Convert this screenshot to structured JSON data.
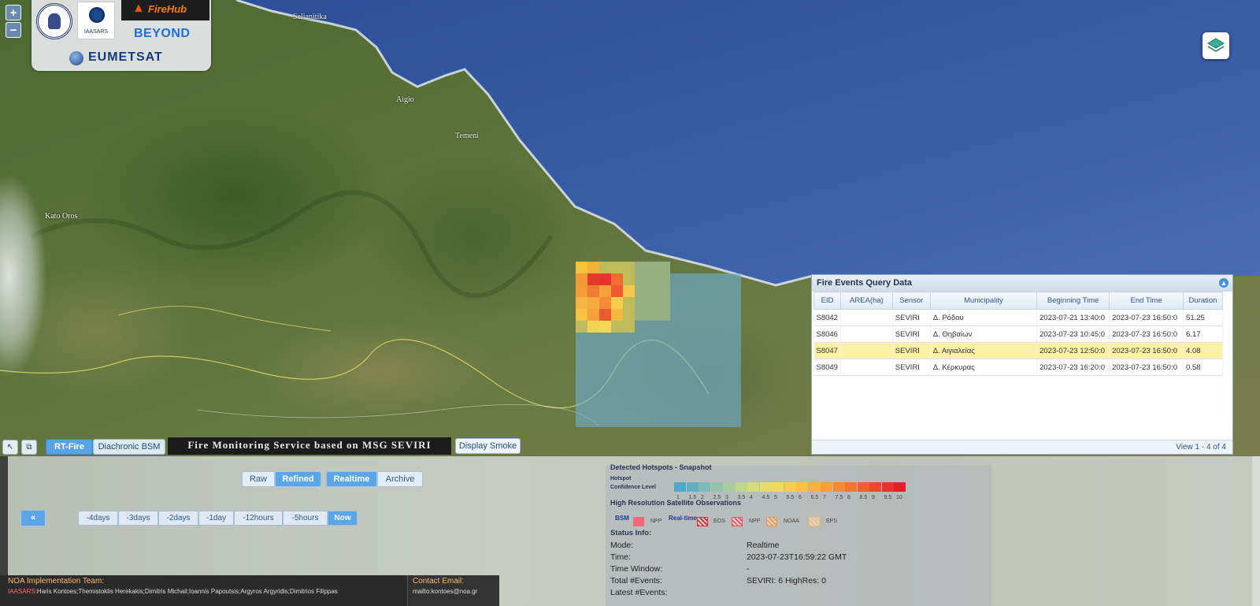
{
  "map": {
    "zoom_in": "+",
    "zoom_out": "−",
    "place_names": [
      "Selianitika",
      "Aigio",
      "Temeni",
      "Kato Oros"
    ],
    "logos": {
      "firehub": "FireHub",
      "beyond": "BEYOND",
      "eumetsat": "EUMETSAT",
      "iaasars": "IAASARS"
    },
    "layers_icon": "layers-icon"
  },
  "events_panel": {
    "title": "Fire Events Query Data",
    "columns": [
      "EID",
      "AREA(ha)",
      "Sensor",
      "Municipality",
      "Beginning Time",
      "End Time",
      "Duration"
    ],
    "rows": [
      {
        "eid": "S8042",
        "area": "",
        "sensor": "SEVIRI",
        "municipality": "Δ. Ρόδου",
        "begin": "2023-07-21 13:40:0",
        "end": "2023-07-23 16:50:0",
        "duration": "51.25"
      },
      {
        "eid": "S8046",
        "area": "",
        "sensor": "SEVIRI",
        "municipality": "Δ. Θηβαίων",
        "begin": "2023-07-23 10:45:0",
        "end": "2023-07-23 16:50:0",
        "duration": "6.17"
      },
      {
        "eid": "S8047",
        "area": "",
        "sensor": "SEVIRI",
        "municipality": "Δ. Αιγιαλείας",
        "begin": "2023-07-23 12:50:0",
        "end": "2023-07-23 16:50:0",
        "duration": "4.08"
      },
      {
        "eid": "S8049",
        "area": "",
        "sensor": "SEVIRI",
        "municipality": "Δ. Κέρκυρας",
        "begin": "2023-07-23 16:20:0",
        "end": "2023-07-23 16:50:0",
        "duration": "0.58"
      }
    ],
    "selected_row": 2,
    "footer": "View 1 - 4 of 4"
  },
  "toolbar": {
    "rt_fire": "RT-Fire",
    "diachronic": "Diachronic BSM",
    "title": "Fire Monitoring Service based on MSG SEVIRI",
    "display_smoke": "Display Smoke"
  },
  "controls": {
    "raw": "Raw",
    "refined": "Refined",
    "realtime": "Realtime",
    "archive": "Archive",
    "play": "«",
    "time_buttons": [
      "-4days",
      "-3days",
      "-2days",
      "-1day",
      "-12hours",
      "-5hours",
      "Now"
    ]
  },
  "legend": {
    "snapshot_title": "Detected Hotspots - Snapshot",
    "hotspot_label": "Hotspot",
    "confidence_label": "Confidence Level",
    "ramp_values": [
      "1",
      "1.5",
      "2",
      "2.5",
      "3",
      "3.5",
      "4",
      "4.5",
      "5",
      "5.5",
      "6",
      "6.5",
      "7",
      "7.5",
      "8",
      "8.5",
      "9",
      "9.5",
      "10"
    ],
    "ramp_colors": [
      "#4fa7c9",
      "#63b0c3",
      "#7dbab9",
      "#93c3ad",
      "#a9cc9e",
      "#bfd48e",
      "#d5da7d",
      "#e8dd6b",
      "#f4d95a",
      "#f9cd4c",
      "#fbbf44",
      "#fbb03e",
      "#f99e3a",
      "#f78a36",
      "#f47433",
      "#f05d31",
      "#ec472f",
      "#e8322d",
      "#e41f2b"
    ],
    "hr_title": "High Resolution Satellite Observations",
    "bsm": "BSM",
    "npp": "NPP",
    "realtime": "Real-time",
    "eos": "EOS",
    "npp2": "NPP",
    "noaa": "NOAA",
    "eps": "EPS",
    "hr_colors": {
      "bsm_npp": "#f06a7a",
      "eos": "#d9323e",
      "npp": "#e95a64",
      "noaa": "#e99c4a",
      "eps": "#eec07a"
    }
  },
  "status": {
    "title": "Status Info:",
    "rows": [
      {
        "label": "Mode:",
        "value": "Realtime"
      },
      {
        "label": "Time:",
        "value": "2023-07-23T16:59:22 GMT"
      },
      {
        "label": "Time Window:",
        "value": "-"
      },
      {
        "label": "Total #Events:",
        "value": "SEVIRI: 6  HighRes: 0"
      },
      {
        "label": "Latest #Events:",
        "value": ""
      }
    ]
  },
  "footer": {
    "team_title": "NOA Implementation Team:",
    "team_inst": "IAASARS",
    "team_names": ":Haris Kontoes;Themistoklis Herekakis;Dimitris Michail;Ioannis Papoutsis;Argyros Argyridis;Dimitrios Filippas",
    "contact_title": "Contact Email:",
    "contact_mail": "mailto:kontoes@noa.gr"
  }
}
